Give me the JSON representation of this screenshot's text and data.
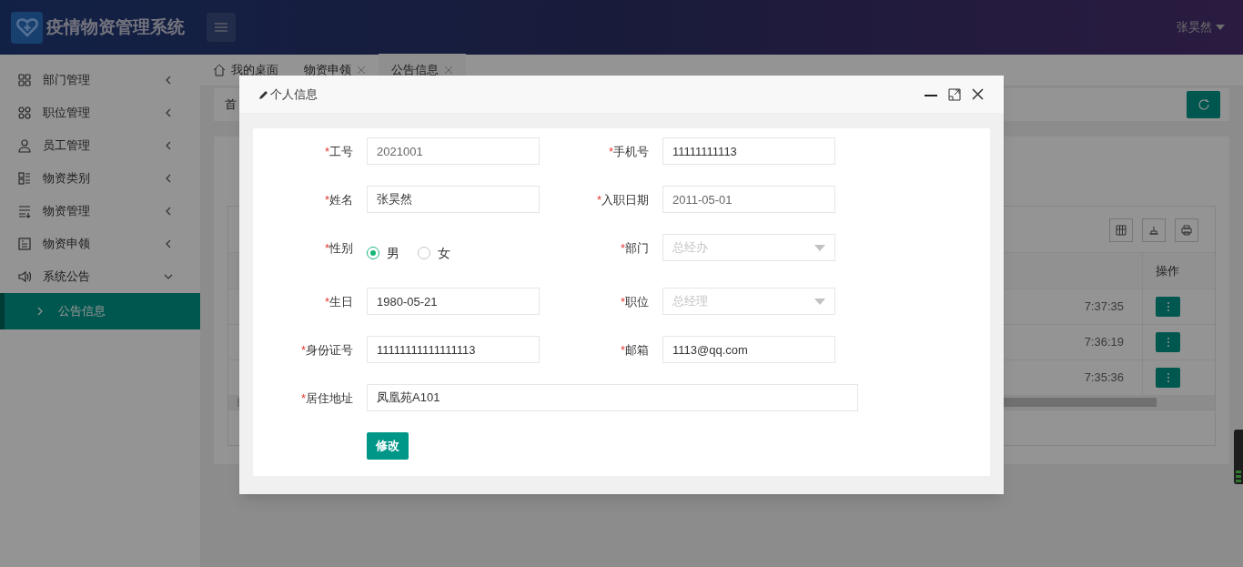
{
  "header": {
    "title": "疫情物资管理系统",
    "user": "张昊然"
  },
  "sidebar": {
    "items": [
      {
        "label": "部门管理",
        "expanded": false
      },
      {
        "label": "职位管理",
        "expanded": false
      },
      {
        "label": "员工管理",
        "expanded": false
      },
      {
        "label": "物资类别",
        "expanded": false
      },
      {
        "label": "物资管理",
        "expanded": false
      },
      {
        "label": "物资申领",
        "expanded": false
      },
      {
        "label": "系统公告",
        "expanded": true,
        "children": [
          {
            "label": "公告信息",
            "selected": true
          }
        ]
      }
    ]
  },
  "tabs": [
    {
      "label": "我的桌面",
      "kind": "home",
      "selected": false
    },
    {
      "label": "物资申领",
      "kind": "closable",
      "selected": false
    },
    {
      "label": "公告信息",
      "kind": "closable",
      "selected": true
    }
  ],
  "breadcrumb": "首",
  "table": {
    "column": "操作",
    "rows": [
      {
        "time": "7:37:35"
      },
      {
        "time": "7:36:19"
      },
      {
        "time": "7:35:36"
      }
    ]
  },
  "dialog": {
    "title": "个人信息",
    "fields": [
      {
        "kind": "text",
        "mark": "*",
        "label": "工号",
        "value": "2021001",
        "disabled": true
      },
      {
        "kind": "text",
        "mark": "*",
        "label": "手机号",
        "value": "11111111113",
        "disabled": false
      },
      {
        "kind": "text",
        "mark": "*",
        "label": "姓名",
        "value": "张昊然",
        "disabled": false
      },
      {
        "kind": "text",
        "mark": "*",
        "label": "入职日期",
        "value": "2011-05-01",
        "disabled": true
      },
      {
        "kind": "radio",
        "mark": "*",
        "label": "性别",
        "options": [
          {
            "label": "男",
            "selected": true
          },
          {
            "label": "女",
            "selected": false
          }
        ]
      },
      {
        "kind": "select",
        "mark": "*",
        "label": "部门",
        "value": "总经办",
        "disabled": true
      },
      {
        "kind": "text",
        "mark": "*",
        "label": "生日",
        "value": "1980-05-21",
        "disabled": false
      },
      {
        "kind": "select",
        "mark": "*",
        "label": "职位",
        "value": "总经理",
        "disabled": true
      },
      {
        "kind": "text",
        "mark": "*",
        "label": "身份证号",
        "value": "11111111111111113",
        "disabled": false
      },
      {
        "kind": "text",
        "mark": "*",
        "label": "邮箱",
        "value": "1113@qq.com",
        "disabled": false
      },
      {
        "kind": "wide",
        "mark": "*",
        "label": "居住地址",
        "value": "凤凰苑A101",
        "disabled": false
      }
    ],
    "submit": "修改"
  }
}
